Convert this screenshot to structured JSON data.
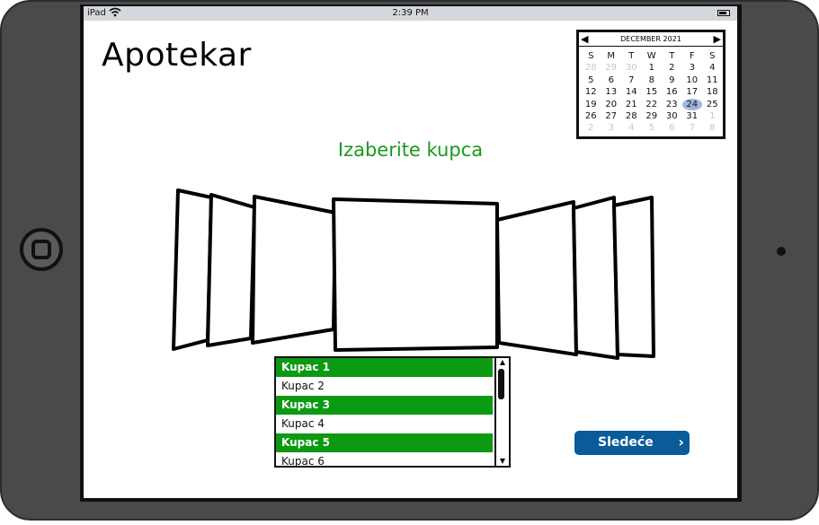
{
  "statusbar": {
    "carrier": "iPad",
    "time": "2:39 PM"
  },
  "app": {
    "title": "Apotekar"
  },
  "calendar": {
    "month_label": "DECEMBER 2021",
    "weekdays": [
      "S",
      "M",
      "T",
      "W",
      "T",
      "F",
      "S"
    ],
    "weeks": [
      [
        "28",
        "29",
        "30",
        "1",
        "2",
        "3",
        "4"
      ],
      [
        "5",
        "6",
        "7",
        "8",
        "9",
        "10",
        "11"
      ],
      [
        "12",
        "13",
        "14",
        "15",
        "16",
        "17",
        "18"
      ],
      [
        "19",
        "20",
        "21",
        "22",
        "23",
        "24",
        "25"
      ],
      [
        "26",
        "27",
        "28",
        "29",
        "30",
        "31",
        "1"
      ],
      [
        "2",
        "3",
        "4",
        "5",
        "6",
        "7",
        "8"
      ]
    ],
    "selected_day": "24"
  },
  "subtitle": "Izaberite kupca",
  "list": {
    "items": [
      "Kupac 1",
      "Kupac 2",
      "Kupac 3",
      "Kupac 4",
      "Kupac 5",
      "Kupac 6"
    ],
    "highlighted": [
      true,
      false,
      true,
      false,
      true,
      false
    ]
  },
  "next_button": {
    "label": "Sledeće"
  },
  "colors": {
    "accent_green": "#0b9a12",
    "title_green": "#1a9a1a",
    "button_blue": "#0a5b9a",
    "selected_day": "#9fb6dc"
  }
}
